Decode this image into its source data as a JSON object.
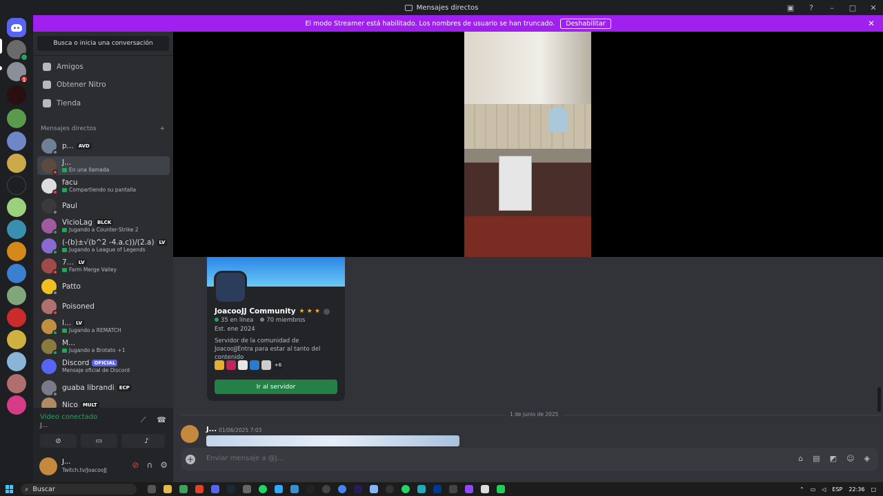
{
  "window": {
    "title": "Mensajes directos"
  },
  "banner": {
    "text": "El modo Streamer está habilitado. Los nombres de usuario se han truncado.",
    "button": "Deshabilitar"
  },
  "servers": {
    "badge": "1"
  },
  "search": {
    "placeholder": "Busca o inicia una conversación"
  },
  "nav": {
    "friends": "Amigos",
    "nitro": "Obtener Nitro",
    "store": "Tienda"
  },
  "dm_header": {
    "label": "Mensajes directos",
    "add": "+"
  },
  "dms": [
    {
      "name": "p...",
      "tag": "AVD",
      "sub": ""
    },
    {
      "name": "J...",
      "tag": "",
      "sub": "En una llamada"
    },
    {
      "name": "facu",
      "tag": "",
      "sub": "Compartiendo su pantalla"
    },
    {
      "name": "Paul",
      "tag": "",
      "sub": ""
    },
    {
      "name": "VicioLag",
      "tag": "BLCK",
      "sub": "Jugando a Counter-Strike 2"
    },
    {
      "name": "(-(b)±√(b^2 -4.a.c))/(2.a)",
      "tag": "LV",
      "sub": "Jugando a League of Legends"
    },
    {
      "name": "7...",
      "tag": "LV",
      "sub": "Farm Merge Valley"
    },
    {
      "name": "Patto",
      "tag": "",
      "sub": ""
    },
    {
      "name": "Poisoned",
      "tag": "",
      "sub": ""
    },
    {
      "name": "I...",
      "tag": "LV",
      "sub": "Jugando a REMATCH"
    },
    {
      "name": "M...",
      "tag": "",
      "sub": "Jugando a Brotato",
      "extra": "+1"
    },
    {
      "name": "Discord",
      "tag": "OFICIAL",
      "sub": "Mensaje oficial de Discord"
    },
    {
      "name": "guaba librandi",
      "tag": "ECP",
      "sub": ""
    },
    {
      "name": "Nico",
      "tag": "MULT",
      "sub": ""
    }
  ],
  "voice": {
    "status": "Video conectado",
    "channel": "J..."
  },
  "user": {
    "name": "J...",
    "status": "Twitch.tv/JoacooJJ"
  },
  "invite": {
    "name": "JoacooJJ Community",
    "online": "35 en línea",
    "members": "70 miembros",
    "est": "Est. ene 2024",
    "description": "Servidor de la comunidad de JoacooJJEntra para estar al tanto del contenido",
    "more": "+6",
    "button": "Ir al servidor"
  },
  "chat": {
    "date_divider": "1 de junio de 2025",
    "author": "J...",
    "timestamp": "01/06/2025 7:03",
    "composer_placeholder": "Enviar mensaje a @J..."
  },
  "taskbar": {
    "search": "Buscar",
    "lang": "ESP",
    "time": "22:36"
  },
  "colors": {
    "accent": "#5865f2",
    "streamer_banner": "#a020f0",
    "online": "#23a55a",
    "dnd": "#f23f43"
  }
}
